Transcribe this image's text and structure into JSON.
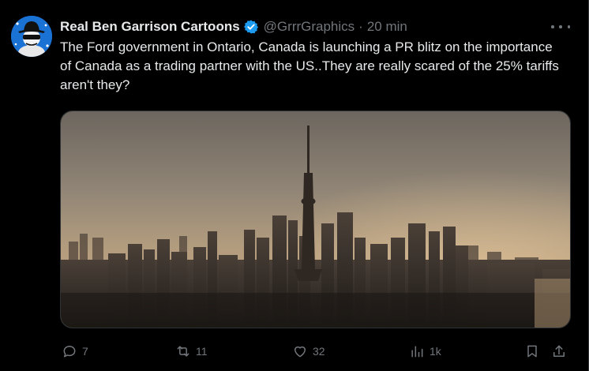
{
  "post": {
    "author": {
      "display_name": "Real Ben Garrison Cartoons",
      "handle": "@GrrrGraphics",
      "separator": "·",
      "time": "20 min",
      "verified": true
    },
    "text": "The Ford government in Ontario, Canada is launching a PR blitz on the importance of Canada as a trading partner with the US..They are really scared of the 25% tariffs aren't they?",
    "media": {
      "type": "image",
      "subject": "hazy sunset over the Toronto skyline with the CN Tower"
    },
    "actions": {
      "replies": "7",
      "reposts": "11",
      "likes": "32",
      "views": "1k"
    }
  },
  "icons": {
    "more": "more-horizontal-icon",
    "reply": "reply-icon",
    "repost": "repost-icon",
    "like": "heart-icon",
    "views": "views-icon",
    "bookmark": "bookmark-icon",
    "share": "share-icon",
    "verified": "verified-badge-icon"
  },
  "colors": {
    "background": "#000000",
    "text": "#e7e9ea",
    "secondary": "#71767b",
    "verified": "#1d9bf0",
    "border": "#2f3336"
  }
}
